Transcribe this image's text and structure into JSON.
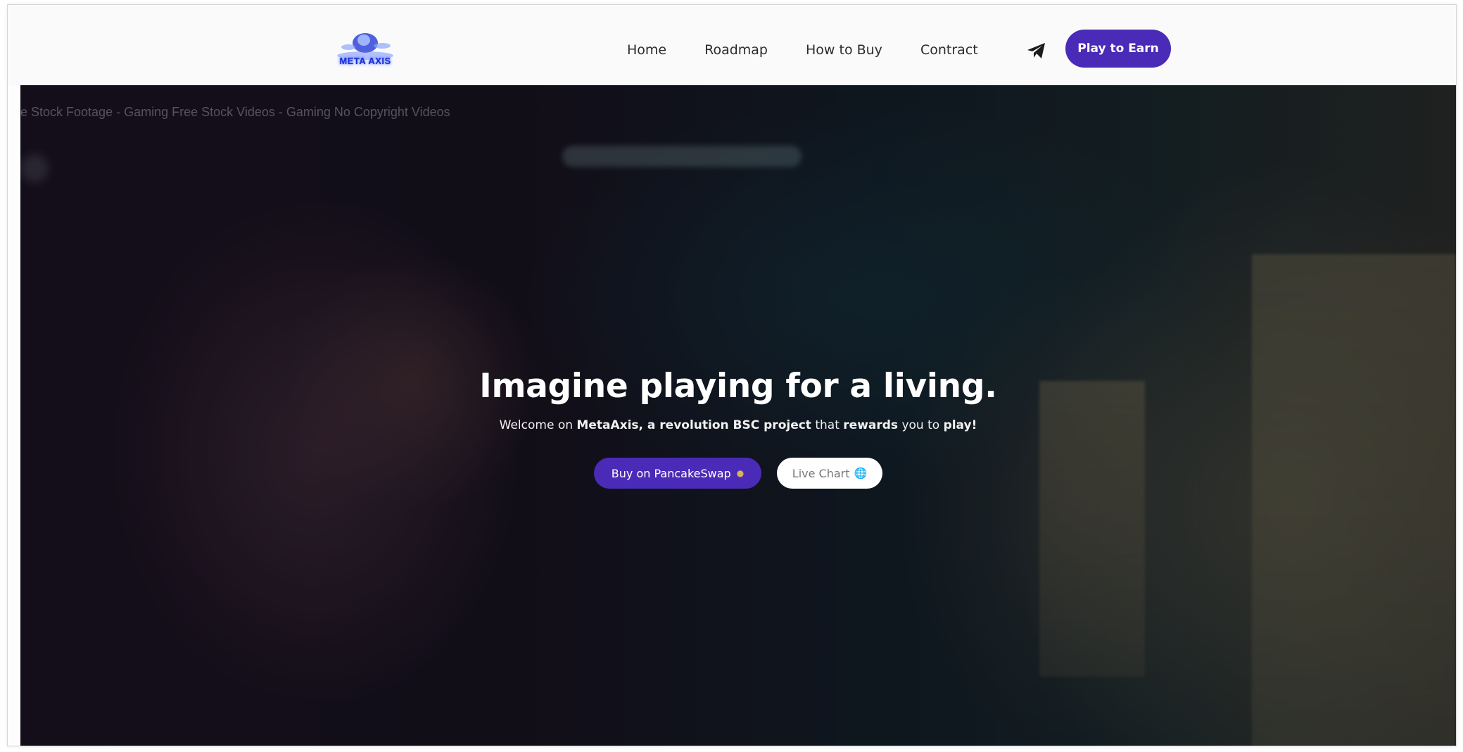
{
  "header": {
    "logo_text": "META AXIS",
    "nav": [
      {
        "label": "Home"
      },
      {
        "label": "Roadmap"
      },
      {
        "label": "How to Buy"
      },
      {
        "label": "Contract"
      }
    ],
    "telegram_icon": "telegram-icon",
    "cta_label": "Play to Earn"
  },
  "hero": {
    "watermark": "e Stock Footage - Gaming Free Stock Videos - Gaming No Copyright Videos",
    "title": "Imagine playing for a living.",
    "subtitle": {
      "p1": "Welcome on ",
      "b1": "MetaAxis, a revolution BSC project",
      "p2": " that ",
      "b2": "rewards",
      "p3": " you to ",
      "b3": "play!"
    },
    "buy_button": {
      "label": "Buy on PancakeSwap",
      "icon": "pancake-icon"
    },
    "chart_button": {
      "label": "Live Chart",
      "icon": "globe-icon"
    }
  },
  "colors": {
    "accent": "#4a2bb8",
    "header_bg": "#fafafa",
    "hero_text": "#ffffff"
  }
}
